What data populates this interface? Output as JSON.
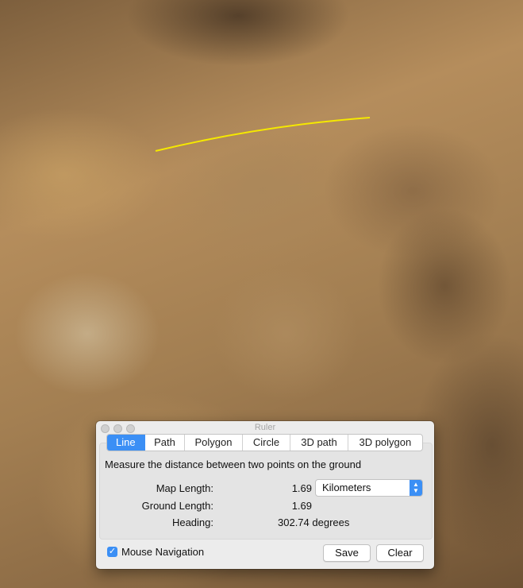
{
  "window": {
    "title": "Ruler"
  },
  "tabs": [
    {
      "label": "Line",
      "active": true
    },
    {
      "label": "Path",
      "active": false
    },
    {
      "label": "Polygon",
      "active": false
    },
    {
      "label": "Circle",
      "active": false
    },
    {
      "label": "3D path",
      "active": false
    },
    {
      "label": "3D polygon",
      "active": false
    }
  ],
  "description": "Measure the distance between two points on the ground",
  "fields": {
    "map_length": {
      "label": "Map Length:",
      "value": "1.69"
    },
    "ground_length": {
      "label": "Ground Length:",
      "value": "1.69"
    },
    "heading": {
      "label": "Heading:",
      "value": "302.74 degrees"
    }
  },
  "units": {
    "selected": "Kilometers"
  },
  "mouse_navigation": {
    "label": "Mouse Navigation",
    "checked": true
  },
  "buttons": {
    "save": "Save",
    "clear": "Clear"
  },
  "colors": {
    "accent": "#3b8ff5",
    "measurement_line": "#f5e800"
  }
}
